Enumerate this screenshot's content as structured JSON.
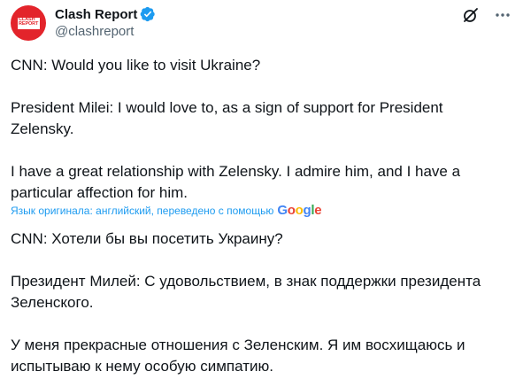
{
  "author": {
    "display_name": "Clash Report",
    "handle": "@clashreport",
    "avatar_logo_text": "CLASH\nREPORT",
    "verified": true
  },
  "icons": {
    "verified": "verified-badge-icon",
    "grok": "grok-icon",
    "more": "more-options-icon"
  },
  "colors": {
    "brand_red": "#e3242b",
    "link_blue": "#1d9bf0",
    "verified_blue": "#1d9bf0",
    "text": "#0f1419",
    "muted": "#536471"
  },
  "tweet": {
    "original_text": "CNN: Would you like to visit Ukraine?\n\nPresident Milei: I would love to, as a sign of support for President\nZelensky.\n\nI have a great relationship with Zelensky. I admire him, and I have a\nparticular affection for him.",
    "translation_note": "Язык оригинала: английский, переведено с помощью",
    "translation_provider": "Google",
    "translated_text": "CNN: Хотели бы вы посетить Украину?\n\nПрезидент Милей: С удовольствием, в знак поддержки президента\nЗеленского.\n\nУ меня прекрасные отношения с Зеленским. Я им восхищаюсь и\nиспытываю к нему особую симпатию."
  }
}
